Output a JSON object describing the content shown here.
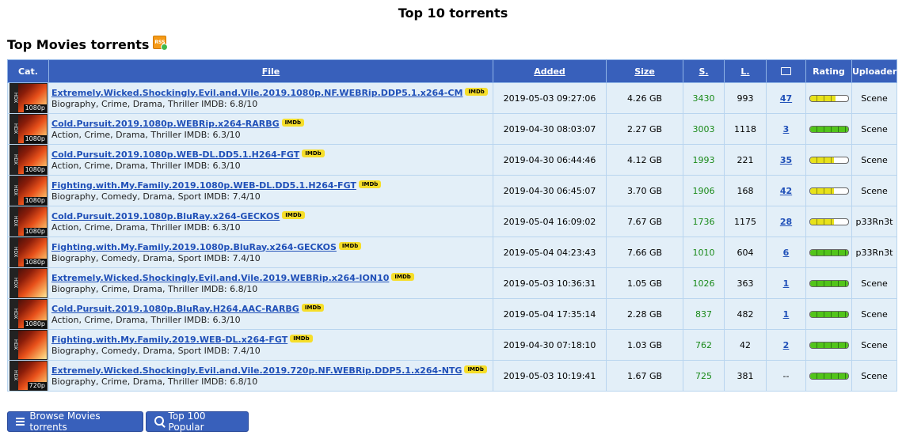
{
  "page_title": "Top 10 torrents",
  "section_title": "Top Movies torrents",
  "rss_icon": "rss-icon",
  "columns": {
    "cat": "Cat.",
    "file": "File",
    "added": "Added",
    "size": "Size",
    "seeders": "S.",
    "leechers": "L.",
    "comments_icon": "comments-icon",
    "rating": "Rating",
    "uploader": "Uploader"
  },
  "imdb_badge": "IMDb",
  "rows": [
    {
      "res": "1080p",
      "file": "Extremely.Wicked.Shockingly.Evil.and.Vile.2019.1080p.NF.WEBRip.DDP5.1.x264-CM",
      "genre": "Biography, Crime, Drama, Thriller IMDB: 6.8/10",
      "added": "2019-05-03 09:27:06",
      "size": "4.26 GB",
      "seeders": "3430",
      "leechers": "993",
      "comments": "47",
      "rating": 0.68,
      "uploader": "Scene"
    },
    {
      "res": "1080p",
      "file": "Cold.Pursuit.2019.1080p.WEBRip.x264-RARBG",
      "genre": "Action, Crime, Drama, Thriller IMDB: 6.3/10",
      "added": "2019-04-30 08:03:07",
      "size": "2.27 GB",
      "seeders": "3003",
      "leechers": "1118",
      "comments": "3",
      "rating": 1.0,
      "uploader": "Scene"
    },
    {
      "res": "1080p",
      "file": "Cold.Pursuit.2019.1080p.WEB-DL.DD5.1.H264-FGT",
      "genre": "Action, Crime, Drama, Thriller IMDB: 6.3/10",
      "added": "2019-04-30 06:44:46",
      "size": "4.12 GB",
      "seeders": "1993",
      "leechers": "221",
      "comments": "35",
      "rating": 0.63,
      "uploader": "Scene"
    },
    {
      "res": "1080p",
      "file": "Fighting.with.My.Family.2019.1080p.WEB-DL.DD5.1.H264-FGT",
      "genre": "Biography, Comedy, Drama, Sport IMDB: 7.4/10",
      "added": "2019-04-30 06:45:07",
      "size": "3.70 GB",
      "seeders": "1906",
      "leechers": "168",
      "comments": "42",
      "rating": 0.63,
      "uploader": "Scene"
    },
    {
      "res": "1080p",
      "file": "Cold.Pursuit.2019.1080p.BluRay.x264-GECKOS",
      "genre": "Action, Crime, Drama, Thriller IMDB: 6.3/10",
      "added": "2019-05-04 16:09:02",
      "size": "7.67 GB",
      "seeders": "1736",
      "leechers": "1175",
      "comments": "28",
      "rating": 0.63,
      "uploader": "p33Rn3t"
    },
    {
      "res": "1080p",
      "file": "Fighting.with.My.Family.2019.1080p.BluRay.x264-GECKOS",
      "genre": "Biography, Comedy, Drama, Sport IMDB: 7.4/10",
      "added": "2019-05-04 04:23:43",
      "size": "7.66 GB",
      "seeders": "1010",
      "leechers": "604",
      "comments": "6",
      "rating": 1.0,
      "uploader": "p33Rn3t"
    },
    {
      "res": "",
      "file": "Extremely.Wicked.Shockingly.Evil.and.Vile.2019.WEBRip.x264-ION10",
      "genre": "Biography, Crime, Drama, Thriller IMDB: 6.8/10",
      "added": "2019-05-03 10:36:31",
      "size": "1.05 GB",
      "seeders": "1026",
      "leechers": "363",
      "comments": "1",
      "rating": 1.0,
      "uploader": "Scene"
    },
    {
      "res": "1080p",
      "file": "Cold.Pursuit.2019.1080p.BluRay.H264.AAC-RARBG",
      "genre": "Action, Crime, Drama, Thriller IMDB: 6.3/10",
      "added": "2019-05-04 17:35:14",
      "size": "2.28 GB",
      "seeders": "837",
      "leechers": "482",
      "comments": "1",
      "rating": 1.0,
      "uploader": "Scene"
    },
    {
      "res": "",
      "file": "Fighting.with.My.Family.2019.WEB-DL.x264-FGT",
      "genre": "Biography, Comedy, Drama, Sport IMDB: 7.4/10",
      "added": "2019-04-30 07:18:10",
      "size": "1.03 GB",
      "seeders": "762",
      "leechers": "42",
      "comments": "2",
      "rating": 1.0,
      "uploader": "Scene"
    },
    {
      "res": "720p",
      "file": "Extremely.Wicked.Shockingly.Evil.and.Vile.2019.720p.NF.WEBRip.DDP5.1.x264-NTG",
      "genre": "Biography, Crime, Drama, Thriller IMDB: 6.8/10",
      "added": "2019-05-03 10:19:41",
      "size": "1.67 GB",
      "seeders": "725",
      "leechers": "381",
      "comments": "--",
      "rating": 1.0,
      "uploader": "Scene"
    }
  ],
  "buttons": {
    "browse": "Browse Movies torrents",
    "top100": "Top 100 Popular"
  },
  "colors": {
    "header_bg": "#3860bb",
    "row_bg": "#e3eff8",
    "link": "#2050b8",
    "seeders": "#1a8a1a",
    "imdb_badge": "#f6de2a"
  }
}
